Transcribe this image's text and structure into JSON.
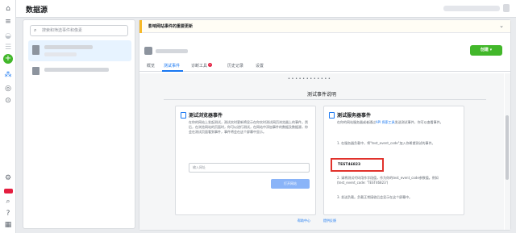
{
  "app": {
    "title": "数据源"
  },
  "rail": {
    "icons": [
      "home-icon",
      "menu-icon",
      "layers-icon",
      "list-icon",
      "add-icon",
      "network-icon",
      "settings-circle-icon",
      "activity-icon",
      "gear-icon",
      "notification-badge",
      "search-icon",
      "help-icon",
      "grid-icon"
    ]
  },
  "sidebar": {
    "search_placeholder": "搜索和筛选事件和像素"
  },
  "alert": {
    "text": "影响网站事件的重要更新"
  },
  "tabs": [
    {
      "label": "概览"
    },
    {
      "label": "测试事件"
    },
    {
      "label": "诊断工具",
      "badge": "2"
    },
    {
      "label": "历史记录"
    },
    {
      "label": "设置"
    }
  ],
  "action_button": {
    "label": "创建 ▾"
  },
  "content": {
    "section_title": "测试事件说明",
    "browser_card": {
      "title": "测试浏览器事件",
      "text": "在你的网站上发起测试，测试实时更新将显示在你实时测试网页浏览器上的事件。然后，在浏览网站的页面时，你可以进行测试，在网站中添加事件的数据及数据源，你会在测试页面看到事件，事件将会在这个屏幕中显示。",
      "input_placeholder": "输入网址",
      "button_label": "打开网站"
    },
    "server_card": {
      "title": "测试服务器事件",
      "text_pre": "在你的网站服务器或者通过",
      "text_link": "API 探索工具",
      "text_post": "发送测试事件，你可以查看事件。",
      "step1": "1. 在服务器负载中，将\"test_event_code\"加入你希望测试的事件。",
      "test_code": "TEST46823",
      "step2": "2. 请将测试代码用作字段值，作为你的test_event_code参数值。例如(test_event_code: 'TEST46823')",
      "step3": "3. 发送负载。负载正常接收后会显示在这个屏幕中。"
    },
    "footer_help": "帮助中心",
    "footer_feedback": "提供反馈"
  }
}
